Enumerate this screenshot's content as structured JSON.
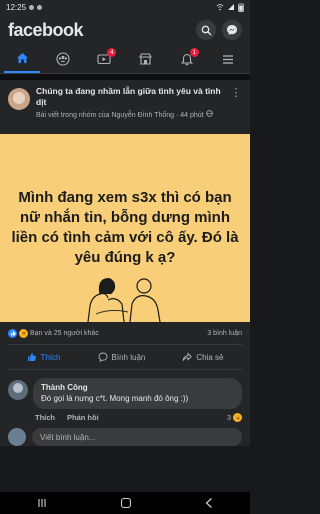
{
  "status": {
    "time": "12:25",
    "right": "◾ 79%"
  },
  "header": {
    "logo": "facebook"
  },
  "nav": {
    "video_badge": "4",
    "notif_badge": "1"
  },
  "post": {
    "title": "Chúng ta đang nhầm lẫn giữa tình yêu và tình dịt",
    "subtitle": "Bài viết trong nhóm của Nguyễn Đình Thống",
    "time": "44 phút",
    "image_text": "Mình đang xem s3x  thì có bạn nữ nhắn tin, bỗng dưng mình liền có tình cảm với cô ấy. Đó là yêu đúng k ạ?",
    "reactions_text": "Bạn và 25 người khác",
    "comments_count": "3 bình luận",
    "like_label": "Thích",
    "comment_label": "Bình luận",
    "share_label": "Chia sẻ"
  },
  "comment": {
    "name": "Thành Công",
    "text": "Đó gọi là nưng c*t. Mong manh đó ông :))",
    "like": "Thích",
    "reply": "Phản hồi",
    "react_count": "3"
  },
  "composer": {
    "placeholder": "Viết bình luận..."
  },
  "colors": {
    "accent": "#2d88ff",
    "image_bg": "#f8cf78"
  }
}
